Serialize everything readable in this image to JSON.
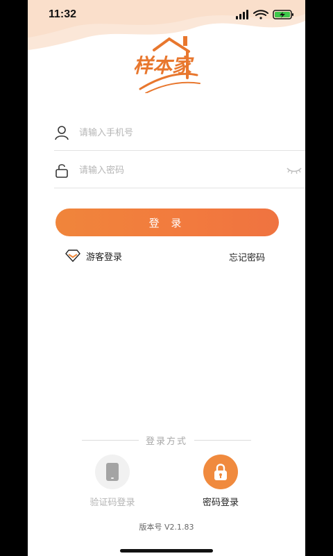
{
  "status_bar": {
    "time": "11:32"
  },
  "brand": {
    "logo_text": "样本家",
    "logo_color": "#e8772e"
  },
  "form": {
    "phone_placeholder": "请输入手机号",
    "password_placeholder": "请输入密码",
    "login_label": "登 录"
  },
  "links": {
    "guest_label": "游客登录",
    "forgot_label": "忘记密码"
  },
  "login_methods": {
    "title": "登录方式",
    "items": [
      {
        "label": "验证码登录",
        "icon": "tablet-icon",
        "active": false
      },
      {
        "label": "密码登录",
        "icon": "lock-icon",
        "active": true
      }
    ]
  },
  "footer": {
    "version": "版本号 V2.1.83"
  },
  "colors": {
    "accent": "#f08a3e",
    "accent_dark": "#ef7340"
  }
}
